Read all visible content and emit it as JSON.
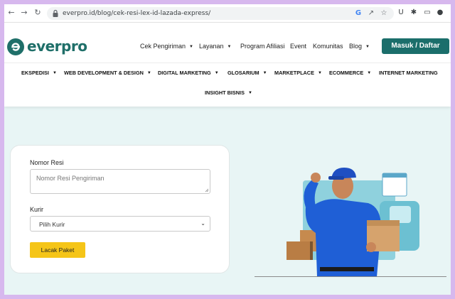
{
  "browser": {
    "url": "everpro.id/blog/cek-resi-lex-id-lazada-express/"
  },
  "icons": {
    "back": "arrow-left-icon",
    "forward": "arrow-right-icon",
    "reload": "reload-icon",
    "lock": "lock-icon",
    "google": "google-icon",
    "share": "share-icon",
    "bookmark": "star-icon",
    "extension_u": "u-extension-icon",
    "extensions": "puzzle-icon",
    "sidepanel": "side-panel-icon",
    "profile": "profile-icon"
  },
  "brand": {
    "name": "everpro",
    "color": "#1f6f69"
  },
  "top_nav": [
    {
      "label": "Cek Pengiriman",
      "dropdown": true
    },
    {
      "label": "Layanan",
      "dropdown": true
    },
    {
      "label": "Program Afiliasi",
      "dropdown": false
    },
    {
      "label": "Event",
      "dropdown": false
    },
    {
      "label": "Komunitas",
      "dropdown": false
    },
    {
      "label": "Blog",
      "dropdown": true
    }
  ],
  "login_button": "Masuk / Daftar",
  "category_nav": [
    {
      "label": "EKSPEDISI",
      "dropdown": true
    },
    {
      "label": "WEB DEVELOPMENT & DESIGN",
      "dropdown": true
    },
    {
      "label": "DIGITAL MARKETING",
      "dropdown": true
    },
    {
      "label": "GLOSARIUM",
      "dropdown": true
    },
    {
      "label": "MARKETPLACE",
      "dropdown": true
    },
    {
      "label": "ECOMMERCE",
      "dropdown": true
    },
    {
      "label": "INTERNET MARKETING",
      "dropdown": false
    },
    {
      "label": "INSIGHT BISNIS",
      "dropdown": true
    }
  ],
  "form": {
    "resi_label": "Nomor Resi",
    "resi_placeholder": "Nomor Resi Pengiriman",
    "courier_label": "Kurir",
    "courier_selected": "Pilih Kurir",
    "submit_label": "Lacak Paket"
  },
  "colors": {
    "page_bg": "#e8f5f5",
    "accent": "#1b6e6b",
    "button_yellow": "#f5c518"
  }
}
